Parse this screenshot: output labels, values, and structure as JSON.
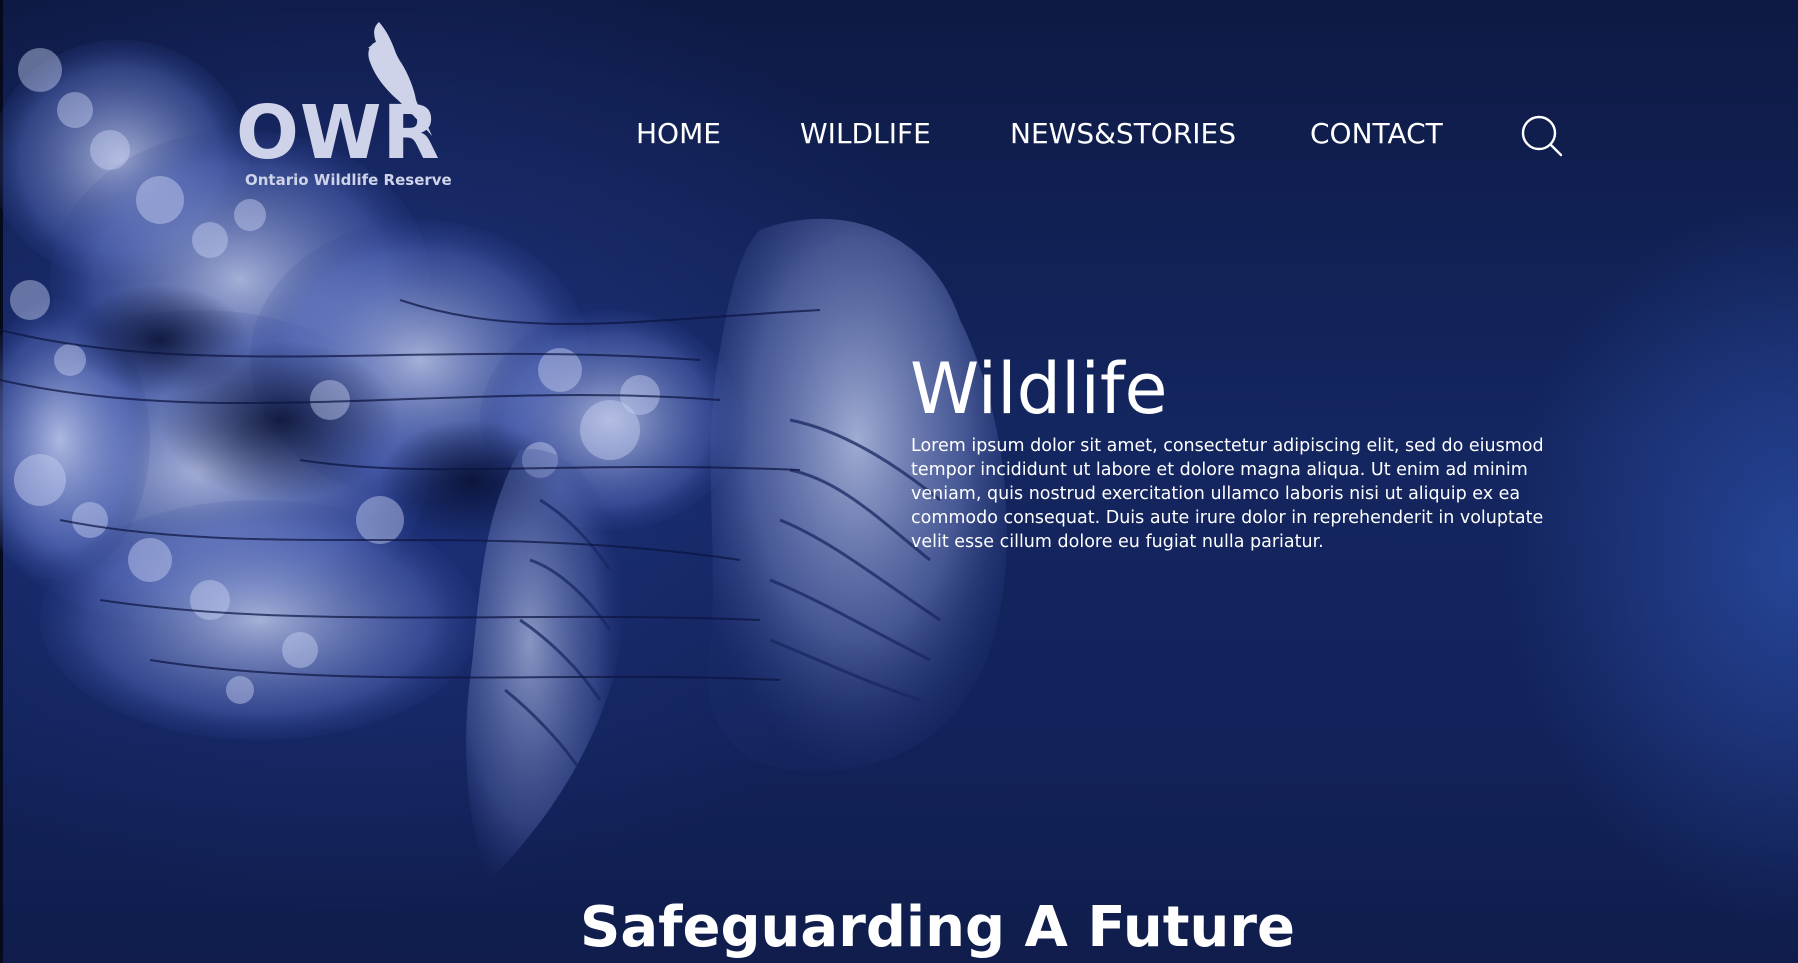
{
  "brand": {
    "letters": "OWR",
    "subtitle": "Ontario Wildlife Reserve",
    "icon": "cardinal-bird-icon",
    "color": "#cfd3ea"
  },
  "nav": {
    "items": [
      {
        "label": "HOME"
      },
      {
        "label": "WILDLIFE"
      },
      {
        "label": "NEWS&STORIES"
      },
      {
        "label": "CONTACT"
      }
    ],
    "search_icon": "search-icon"
  },
  "hero": {
    "title": "Wildlife",
    "body": "Lorem ipsum dolor sit amet, consectetur adipiscing elit, sed do eiusmod tempor incididunt ut labore et dolore magna aliqua. Ut enim ad minim veniam, quis nostrud exercitation ullamco laboris nisi ut aliquip ex ea commodo consequat. Duis aute irure dolor in reprehenderit in voluptate velit esse cillum dolore eu fugiat nulla pariatur.",
    "background_subject": "jellyfish-photo"
  },
  "section": {
    "heading": "Safeguarding A Future"
  },
  "colors": {
    "background_dark": "#0e1a45",
    "background_mid": "#142660",
    "accent_glow": "#2d50aa",
    "text": "#ffffff"
  }
}
